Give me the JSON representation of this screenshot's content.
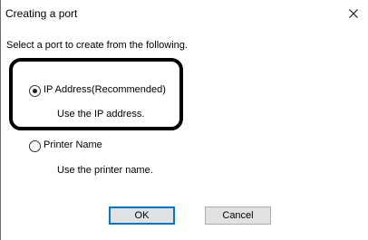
{
  "window": {
    "title": "Creating a port",
    "close_glyph": "close-icon"
  },
  "instruction": "Select a port to create from the following.",
  "options": [
    {
      "label": "IP Address(Recommended)",
      "description": "Use the IP address.",
      "selected": true
    },
    {
      "label": "Printer Name",
      "description": "Use the printer name.",
      "selected": false
    }
  ],
  "buttons": {
    "ok_label": "OK",
    "cancel_label": "Cancel"
  },
  "colors": {
    "default_button_border": "#0078d7",
    "button_face": "#e1e1e1",
    "highlight_box": "#000000"
  }
}
